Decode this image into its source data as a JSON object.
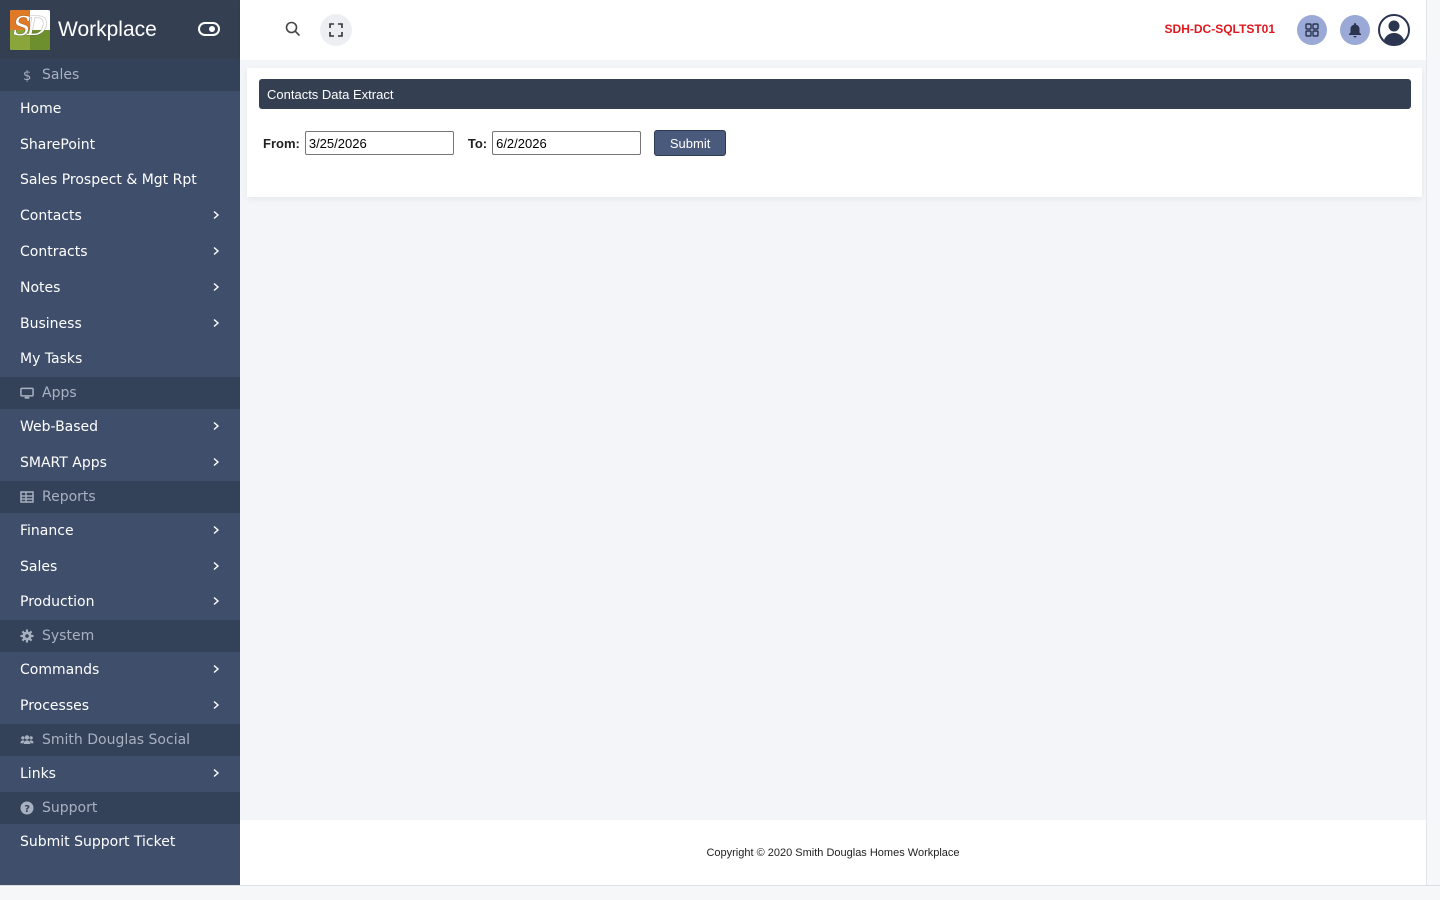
{
  "brand": {
    "title": "Workplace",
    "logo_letters": "SD"
  },
  "sidebar": {
    "sections": [
      {
        "label": "Sales",
        "icon": "dollar-icon",
        "items": [
          {
            "label": "Home",
            "chevron": false
          },
          {
            "label": "SharePoint",
            "chevron": false
          },
          {
            "label": "Sales Prospect & Mgt Rpt",
            "chevron": false
          },
          {
            "label": "Contacts",
            "chevron": true
          },
          {
            "label": "Contracts",
            "chevron": true
          },
          {
            "label": "Notes",
            "chevron": true
          },
          {
            "label": "Business",
            "chevron": true
          },
          {
            "label": "My Tasks",
            "chevron": false
          }
        ]
      },
      {
        "label": "Apps",
        "icon": "monitor-icon",
        "items": [
          {
            "label": "Web-Based",
            "chevron": true
          },
          {
            "label": "SMART Apps",
            "chevron": true
          }
        ]
      },
      {
        "label": "Reports",
        "icon": "table-icon",
        "items": [
          {
            "label": "Finance",
            "chevron": true
          },
          {
            "label": "Sales",
            "chevron": true
          },
          {
            "label": "Production",
            "chevron": true
          }
        ]
      },
      {
        "label": "System",
        "icon": "gear-icon",
        "items": [
          {
            "label": "Commands",
            "chevron": true
          },
          {
            "label": "Processes",
            "chevron": true
          }
        ]
      },
      {
        "label": "Smith Douglas Social",
        "icon": "users-icon",
        "items": [
          {
            "label": "Links",
            "chevron": true
          }
        ]
      },
      {
        "label": "Support",
        "icon": "question-icon",
        "items": [
          {
            "label": "Submit Support Ticket",
            "chevron": false
          }
        ]
      }
    ]
  },
  "topbar": {
    "server_name": "SDH-DC-SQLTST01"
  },
  "card": {
    "title": "Contacts Data Extract",
    "from_label": "From:",
    "from_value": "3/25/2026",
    "to_label": "To:",
    "to_value": "6/2/2026",
    "submit_label": "Submit"
  },
  "footer": {
    "copyright": "Copyright © 2020 Smith Douglas Homes Workplace"
  },
  "colors": {
    "sidebar_bg": "#3e4e6b",
    "section_bg": "#344259",
    "header_bg": "#343f52",
    "server_text": "#e0171e",
    "button_bg": "#4a5a7c"
  }
}
